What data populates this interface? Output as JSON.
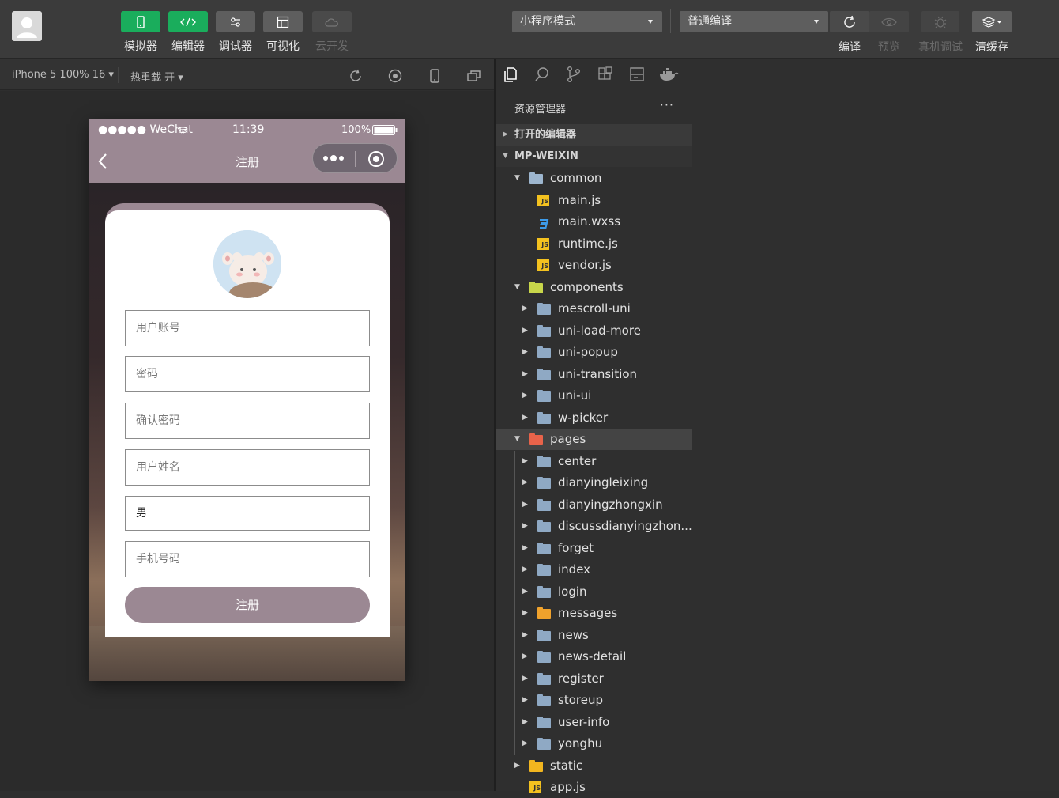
{
  "toolbar": {
    "buttons": [
      {
        "label": "模拟器",
        "icon": "phone-icon"
      },
      {
        "label": "编辑器",
        "icon": "code-icon"
      },
      {
        "label": "调试器",
        "icon": "sliders-icon"
      },
      {
        "label": "可视化",
        "icon": "layout-icon"
      },
      {
        "label": "云开发",
        "icon": "cloud-icon"
      }
    ],
    "mode_select": "小程序模式",
    "compile_select": "普通编译",
    "right_buttons": [
      {
        "label": "编译",
        "icon": "refresh-icon"
      },
      {
        "label": "预览",
        "icon": "eye-icon"
      },
      {
        "label": "真机调试",
        "icon": "bug-icon"
      },
      {
        "label": "清缓存",
        "icon": "layers-icon"
      }
    ]
  },
  "simbar": {
    "device": "iPhone 5 100% 16",
    "hot_reload": "热重载 开"
  },
  "phone": {
    "status": {
      "carrier": "●●●●● WeChat",
      "time": "11:39",
      "battery": "100%"
    },
    "nav_title": "注册",
    "form": {
      "fields": [
        {
          "placeholder": "用户账号",
          "is_value": false
        },
        {
          "placeholder": "密码",
          "is_value": false
        },
        {
          "placeholder": "确认密码",
          "is_value": false
        },
        {
          "placeholder": "用户姓名",
          "is_value": false
        },
        {
          "placeholder": "男",
          "is_value": true
        },
        {
          "placeholder": "手机号码",
          "is_value": false
        }
      ],
      "submit": "注册"
    }
  },
  "explorer": {
    "title": "资源管理器",
    "more": "···",
    "sections": {
      "open_editors": "打开的编辑器",
      "project": "MP-WEIXIN"
    },
    "tree": [
      {
        "name": "common",
        "type": "folder-open",
        "level": 1,
        "open": true
      },
      {
        "name": "main.js",
        "type": "js",
        "level": 2
      },
      {
        "name": "main.wxss",
        "type": "css",
        "level": 2
      },
      {
        "name": "runtime.js",
        "type": "js",
        "level": 2
      },
      {
        "name": "vendor.js",
        "type": "js",
        "level": 2
      },
      {
        "name": "components",
        "type": "folder-components",
        "level": 1,
        "open": true
      },
      {
        "name": "mescroll-uni",
        "type": "folder",
        "level": 2
      },
      {
        "name": "uni-load-more",
        "type": "folder",
        "level": 2
      },
      {
        "name": "uni-popup",
        "type": "folder",
        "level": 2
      },
      {
        "name": "uni-transition",
        "type": "folder",
        "level": 2
      },
      {
        "name": "uni-ui",
        "type": "folder",
        "level": 2
      },
      {
        "name": "w-picker",
        "type": "folder",
        "level": 2
      },
      {
        "name": "pages",
        "type": "folder-pages",
        "level": 1,
        "open": true,
        "selected": true
      },
      {
        "name": "center",
        "type": "folder",
        "level": 2
      },
      {
        "name": "dianyingleixing",
        "type": "folder",
        "level": 2
      },
      {
        "name": "dianyingzhongxin",
        "type": "folder",
        "level": 2
      },
      {
        "name": "discussdianyingzhon...",
        "type": "folder",
        "level": 2
      },
      {
        "name": "forget",
        "type": "folder",
        "level": 2
      },
      {
        "name": "index",
        "type": "folder",
        "level": 2
      },
      {
        "name": "login",
        "type": "folder",
        "level": 2
      },
      {
        "name": "messages",
        "type": "folder-messages",
        "level": 2
      },
      {
        "name": "news",
        "type": "folder",
        "level": 2
      },
      {
        "name": "news-detail",
        "type": "folder",
        "level": 2
      },
      {
        "name": "register",
        "type": "folder",
        "level": 2
      },
      {
        "name": "storeup",
        "type": "folder",
        "level": 2
      },
      {
        "name": "user-info",
        "type": "folder",
        "level": 2
      },
      {
        "name": "yonghu",
        "type": "folder",
        "level": 2
      },
      {
        "name": "static",
        "type": "folder-static",
        "level": 1
      },
      {
        "name": "app.js",
        "type": "js",
        "level": 1
      }
    ]
  },
  "colors": {
    "accent_green": "#1aad5c",
    "nav_mauve": "#9b8893",
    "folder_blue": "#8fa9c4",
    "js_yellow": "#f4c21f",
    "css_blue": "#3d9be9"
  }
}
